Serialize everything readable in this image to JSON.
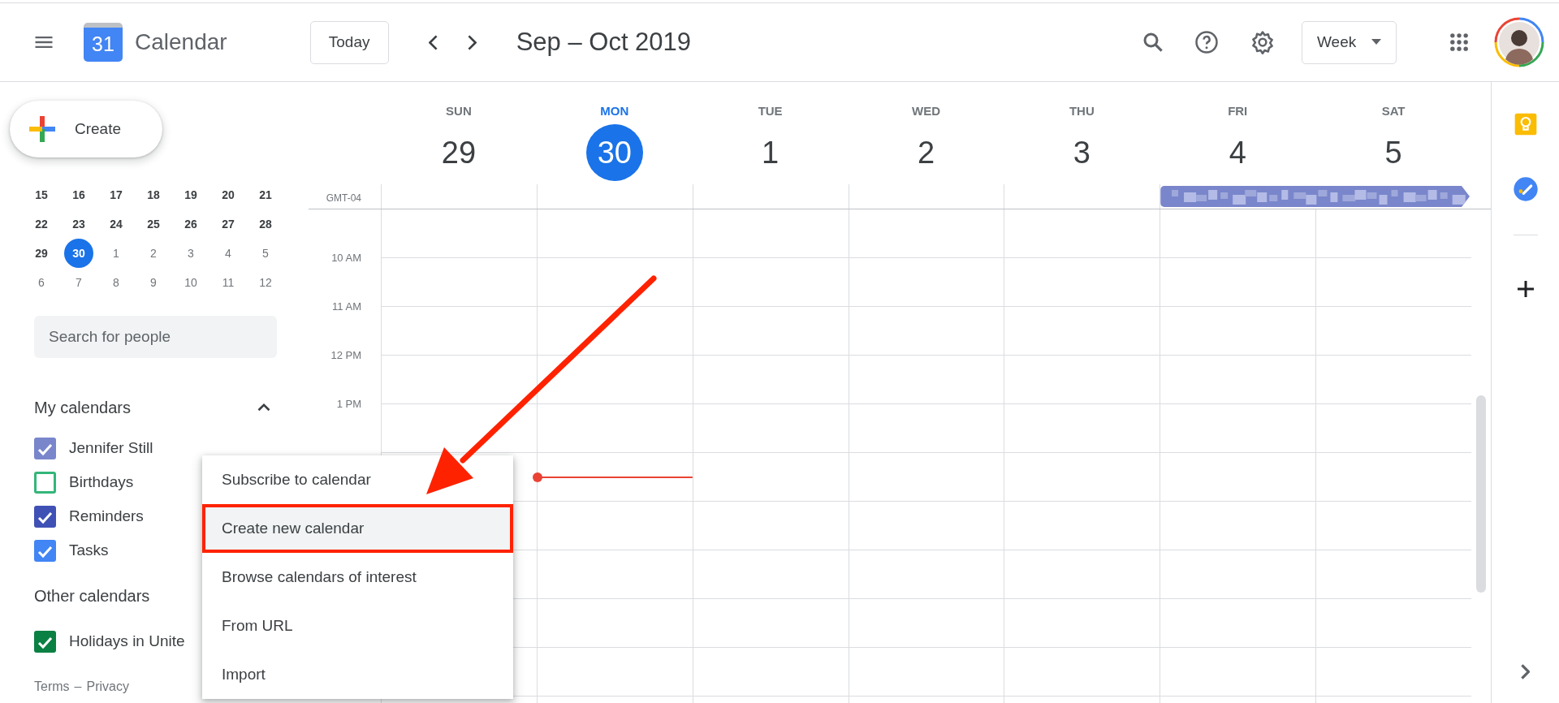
{
  "header": {
    "logo_day": "31",
    "app_name": "Calendar",
    "today_button": "Today",
    "date_range": "Sep – Oct 2019",
    "view_select": "Week"
  },
  "sidebar": {
    "create_button": "Create",
    "mini_calendar": [
      [
        {
          "label": "15",
          "muted": false,
          "selected": false
        },
        {
          "label": "16",
          "muted": false,
          "selected": false
        },
        {
          "label": "17",
          "muted": false,
          "selected": false
        },
        {
          "label": "18",
          "muted": false,
          "selected": false
        },
        {
          "label": "19",
          "muted": false,
          "selected": false
        },
        {
          "label": "20",
          "muted": false,
          "selected": false
        },
        {
          "label": "21",
          "muted": false,
          "selected": false
        }
      ],
      [
        {
          "label": "22",
          "muted": false,
          "selected": false
        },
        {
          "label": "23",
          "muted": false,
          "selected": false
        },
        {
          "label": "24",
          "muted": false,
          "selected": false
        },
        {
          "label": "25",
          "muted": false,
          "selected": false
        },
        {
          "label": "26",
          "muted": false,
          "selected": false
        },
        {
          "label": "27",
          "muted": false,
          "selected": false
        },
        {
          "label": "28",
          "muted": false,
          "selected": false
        }
      ],
      [
        {
          "label": "29",
          "muted": false,
          "selected": false
        },
        {
          "label": "30",
          "muted": false,
          "selected": true
        },
        {
          "label": "1",
          "muted": true,
          "selected": false
        },
        {
          "label": "2",
          "muted": true,
          "selected": false
        },
        {
          "label": "3",
          "muted": true,
          "selected": false
        },
        {
          "label": "4",
          "muted": true,
          "selected": false
        },
        {
          "label": "5",
          "muted": true,
          "selected": false
        }
      ],
      [
        {
          "label": "6",
          "muted": true,
          "selected": false
        },
        {
          "label": "7",
          "muted": true,
          "selected": false
        },
        {
          "label": "8",
          "muted": true,
          "selected": false
        },
        {
          "label": "9",
          "muted": true,
          "selected": false
        },
        {
          "label": "10",
          "muted": true,
          "selected": false
        },
        {
          "label": "11",
          "muted": true,
          "selected": false
        },
        {
          "label": "12",
          "muted": true,
          "selected": false
        }
      ]
    ],
    "search": {
      "placeholder": "Search for people"
    },
    "my_calendars": {
      "title": "My calendars",
      "expanded": true,
      "items": [
        {
          "label": "Jennifer Still",
          "checked": true,
          "color": "#7986cb"
        },
        {
          "label": "Birthdays",
          "checked": false,
          "color": "#33b679"
        },
        {
          "label": "Reminders",
          "checked": true,
          "color": "#3f51b5"
        },
        {
          "label": "Tasks",
          "checked": true,
          "color": "#4285f4"
        }
      ]
    },
    "other_calendars": {
      "title": "Other calendars",
      "items": [
        {
          "label": "Holidays in Unite",
          "checked": true,
          "color": "#0b8043"
        }
      ]
    },
    "footer": {
      "terms": "Terms",
      "separator": "–",
      "privacy": "Privacy"
    }
  },
  "calendar": {
    "timezone": "GMT-04",
    "time_labels": [
      "10 AM",
      "11 AM",
      "12 PM",
      "1 PM"
    ],
    "days": [
      {
        "weekday": "SUN",
        "date": "29",
        "today": false,
        "all_day_event": false
      },
      {
        "weekday": "MON",
        "date": "30",
        "today": true,
        "all_day_event": false
      },
      {
        "weekday": "TUE",
        "date": "1",
        "today": false,
        "all_day_event": false
      },
      {
        "weekday": "WED",
        "date": "2",
        "today": false,
        "all_day_event": false
      },
      {
        "weekday": "THU",
        "date": "3",
        "today": false,
        "all_day_event": false
      },
      {
        "weekday": "FRI",
        "date": "4",
        "today": false,
        "all_day_event": true
      },
      {
        "weekday": "SAT",
        "date": "5",
        "today": false,
        "all_day_event": true
      }
    ]
  },
  "context_menu": {
    "items": [
      {
        "label": "Subscribe to calendar",
        "highlighted": false
      },
      {
        "label": "Create new calendar",
        "highlighted": true
      },
      {
        "label": "Browse calendars of interest",
        "highlighted": false
      },
      {
        "label": "From URL",
        "highlighted": false
      },
      {
        "label": "Import",
        "highlighted": false
      }
    ]
  }
}
